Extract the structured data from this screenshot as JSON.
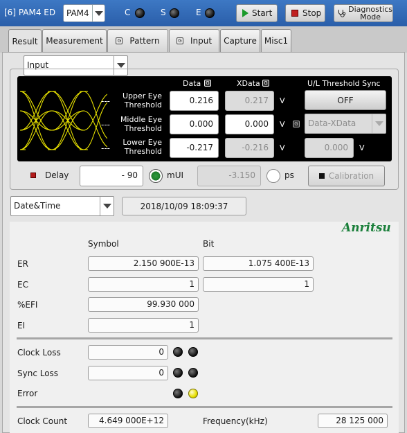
{
  "titlebar": {
    "title": "[6] PAM4 ED",
    "mode_select": "PAM4",
    "indicators": [
      {
        "label": "C",
        "state": "off"
      },
      {
        "label": "S",
        "state": "off"
      },
      {
        "label": "E",
        "state": "off"
      }
    ],
    "start_label": "Start",
    "stop_label": "Stop",
    "diagnostics_line1": "Diagnostics",
    "diagnostics_line2": "Mode"
  },
  "tabs": [
    {
      "label": "Result",
      "active": true,
      "g": false
    },
    {
      "label": "Measurement",
      "active": false,
      "g": false
    },
    {
      "label": "Pattern",
      "active": false,
      "g": true
    },
    {
      "label": "Input",
      "active": false,
      "g": true
    },
    {
      "label": "Capture",
      "active": false,
      "g": false
    },
    {
      "label": "Misc1",
      "active": false,
      "g": false
    }
  ],
  "input_select": "Input",
  "threshold": {
    "col_data": "Data",
    "col_xdata": "XData",
    "col_sync": "U/L Threshold Sync",
    "g_badge": "G",
    "upper_label_1": "Upper Eye",
    "upper_label_2": "Threshold",
    "middle_label_1": "Middle Eye",
    "middle_label_2": "Threshold",
    "lower_label_1": "Lower Eye",
    "lower_label_2": "Threshold",
    "dash": "---",
    "upper_data": "0.216",
    "upper_xdata": "0.217",
    "middle_data": "0.000",
    "middle_xdata": "0.000",
    "lower_data": "-0.217",
    "lower_xdata": "-0.216",
    "unit_v": "V",
    "sync_button": "OFF",
    "sync_select": "Data-XData",
    "sync_value": "0.000"
  },
  "delay": {
    "label": "Delay",
    "value": "- 90",
    "unit_mui": "mUI",
    "ps_value": "-3.150",
    "unit_ps": "ps",
    "selected_unit": "mUI",
    "calibration_label": "Calibration"
  },
  "datetime": {
    "select": "Date&Time",
    "value": "2018/10/09 18:09:37"
  },
  "results": {
    "logo": "Anritsu",
    "col_symbol": "Symbol",
    "col_bit": "Bit",
    "er_label": "ER",
    "er_symbol": "2.150 900E-13",
    "er_bit": "1.075 400E-13",
    "ec_label": "EC",
    "ec_symbol": "1",
    "ec_bit": "1",
    "efi_label": "%EFI",
    "efi_symbol": "99.930 000",
    "ei_label": "EI",
    "ei_symbol": "1",
    "clock_loss_label": "Clock Loss",
    "clock_loss_value": "0",
    "sync_loss_label": "Sync Loss",
    "sync_loss_value": "0",
    "error_label": "Error",
    "error_leds": [
      "off",
      "yellow"
    ],
    "clock_count_label": "Clock Count",
    "clock_count_value": "4.649 000E+12",
    "frequency_label": "Frequency(kHz)",
    "frequency_value": "28 125 000"
  }
}
